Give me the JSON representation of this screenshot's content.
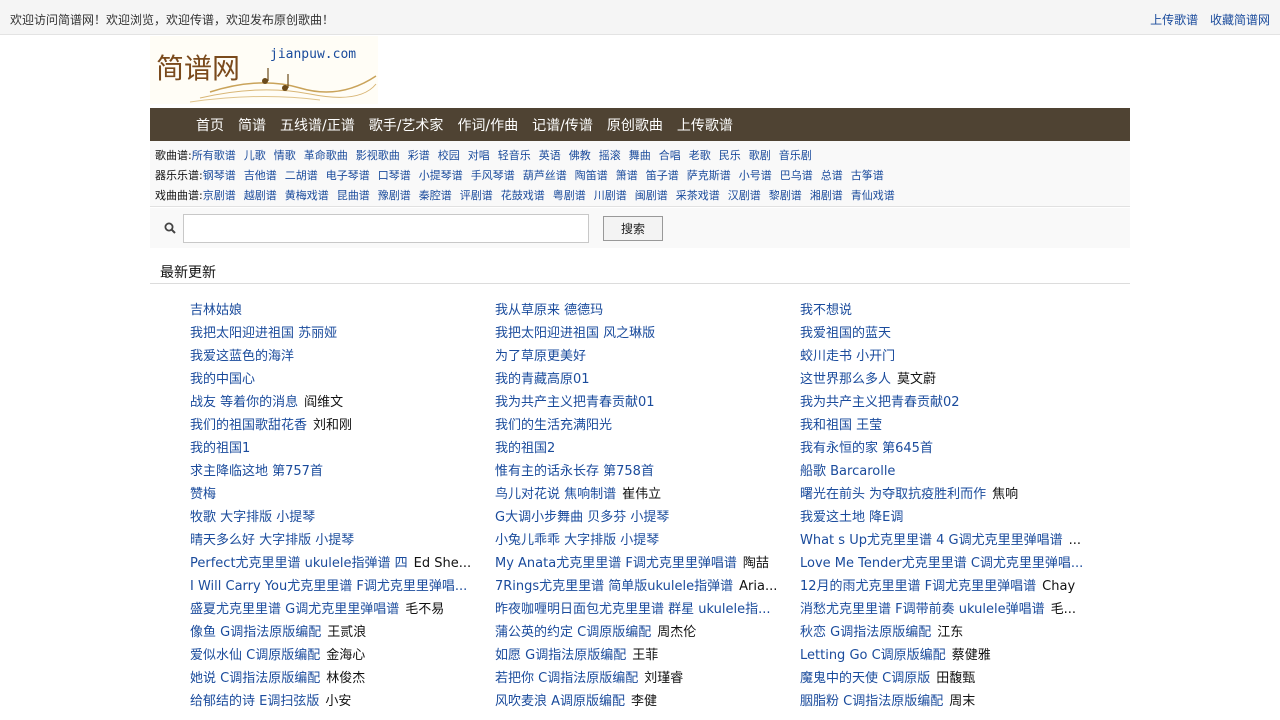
{
  "topbar": {
    "welcome": "欢迎访问简谱网！欢迎浏览，欢迎传谱，欢迎发布原创歌曲！",
    "upload_link": "上传歌谱",
    "bookmark_link": "收藏简谱网"
  },
  "logo": {
    "main": "简谱网",
    "domain": "jianpuw.com"
  },
  "nav": [
    {
      "label": "首页"
    },
    {
      "label": "简谱"
    },
    {
      "label": "五线谱/正谱"
    },
    {
      "label": "歌手/艺术家"
    },
    {
      "label": "作词/作曲"
    },
    {
      "label": "记谱/传谱"
    },
    {
      "label": "原创歌曲"
    },
    {
      "label": "上传歌谱"
    }
  ],
  "categories": {
    "songs": {
      "title": "歌曲谱:",
      "items": [
        "所有歌谱",
        "儿歌",
        "情歌",
        "革命歌曲",
        "影视歌曲",
        "彩谱",
        "校园",
        "对唱",
        "轻音乐",
        "英语",
        "佛教",
        "摇滚",
        "舞曲",
        "合唱",
        "老歌",
        "民乐",
        "歌剧",
        "音乐剧"
      ]
    },
    "instruments": {
      "title": "器乐乐谱:",
      "items": [
        "钢琴谱",
        "吉他谱",
        "二胡谱",
        "电子琴谱",
        "口琴谱",
        "小提琴谱",
        "手风琴谱",
        "葫芦丝谱",
        "陶笛谱",
        "箫谱",
        "笛子谱",
        "萨克斯谱",
        "小号谱",
        "巴乌谱",
        "总谱",
        "古筝谱"
      ]
    },
    "opera": {
      "title": "戏曲曲谱:",
      "items": [
        "京剧谱",
        "越剧谱",
        "黄梅戏谱",
        "昆曲谱",
        "豫剧谱",
        "秦腔谱",
        "评剧谱",
        "花鼓戏谱",
        "粤剧谱",
        "川剧谱",
        "闽剧谱",
        "采茶戏谱",
        "汉剧谱",
        "黎剧谱",
        "湘剧谱",
        "青仙戏谱"
      ]
    }
  },
  "search": {
    "placeholder": "",
    "button_label": "搜索"
  },
  "latest": {
    "title": "最新更新",
    "songs": [
      {
        "title": "吉林姑娘",
        "artist": ""
      },
      {
        "title": "我从草原来 德德玛",
        "artist": ""
      },
      {
        "title": "我不想说",
        "artist": ""
      },
      {
        "title": "我把太阳迎进祖国 苏丽娅",
        "artist": ""
      },
      {
        "title": "我把太阳迎进祖国 风之琳版",
        "artist": ""
      },
      {
        "title": "我爱祖国的蓝天",
        "artist": ""
      },
      {
        "title": "我爱这蓝色的海洋",
        "artist": ""
      },
      {
        "title": "为了草原更美好",
        "artist": ""
      },
      {
        "title": "蛟川走书 小开门",
        "artist": ""
      },
      {
        "title": "我的中国心",
        "artist": ""
      },
      {
        "title": "我的青藏高原01",
        "artist": ""
      },
      {
        "title": "这世界那么多人",
        "artist": "莫文蔚"
      },
      {
        "title": "战友 等着你的消息",
        "artist": "阎维文"
      },
      {
        "title": "我为共产主义把青春贡献01",
        "artist": ""
      },
      {
        "title": "我为共产主义把青春贡献02",
        "artist": ""
      },
      {
        "title": "我们的祖国歌甜花香",
        "artist": "刘和刚"
      },
      {
        "title": "我们的生活充满阳光",
        "artist": ""
      },
      {
        "title": "我和祖国 王莹",
        "artist": ""
      },
      {
        "title": "我的祖国1",
        "artist": ""
      },
      {
        "title": "我的祖国2",
        "artist": ""
      },
      {
        "title": "我有永恒的家 第645首",
        "artist": ""
      },
      {
        "title": "求主降临这地 第757首",
        "artist": ""
      },
      {
        "title": "惟有主的话永长存 第758首",
        "artist": ""
      },
      {
        "title": "船歌 Barcarolle",
        "artist": ""
      },
      {
        "title": "赞梅",
        "artist": ""
      },
      {
        "title": "鸟儿对花说 焦响制谱",
        "artist": "崔伟立"
      },
      {
        "title": "曙光在前头 为夺取抗疫胜利而作",
        "artist": "焦响"
      },
      {
        "title": "牧歌 大字排版 小提琴",
        "artist": ""
      },
      {
        "title": "G大调小步舞曲 贝多芬 小提琴",
        "artist": ""
      },
      {
        "title": "我爱这土地 降E调",
        "artist": ""
      },
      {
        "title": "晴天多么好 大字排版 小提琴",
        "artist": ""
      },
      {
        "title": "小兔儿乖乖 大字排版 小提琴",
        "artist": ""
      },
      {
        "title": "What s Up尤克里里谱 4 G调尤克里里弹唱谱",
        "artist": "..."
      },
      {
        "title": "Perfect尤克里里谱 ukulele指弹谱 四",
        "artist": "Ed She..."
      },
      {
        "title": "My Anata尤克里里谱 F调尤克里里弹唱谱",
        "artist": "陶喆"
      },
      {
        "title": "Love Me Tender尤克里里谱 C调尤克里里弹唱...",
        "artist": ""
      },
      {
        "title": "I Will Carry You尤克里里谱 F调尤克里里弹唱...",
        "artist": ""
      },
      {
        "title": "7Rings尤克里里谱 简单版ukulele指弹谱",
        "artist": "Aria..."
      },
      {
        "title": "12月的雨尤克里里谱 F调尤克里里弹唱谱",
        "artist": "Chay"
      },
      {
        "title": "盛夏尤克里里谱 G调尤克里里弹唱谱",
        "artist": "毛不易"
      },
      {
        "title": "昨夜咖喱明日面包尤克里里谱 群星 ukulele指...",
        "artist": ""
      },
      {
        "title": "消愁尤克里里谱 F调带前奏 ukulele弹唱谱",
        "artist": "毛..."
      },
      {
        "title": "像鱼 G调指法原版编配",
        "artist": "王贰浪"
      },
      {
        "title": "蒲公英的约定 C调原版编配",
        "artist": "周杰伦"
      },
      {
        "title": "秋恋 G调指法原版编配",
        "artist": "江东"
      },
      {
        "title": "爱似水仙 C调原版编配",
        "artist": "金海心"
      },
      {
        "title": "如愿 G调指法原版编配",
        "artist": "王菲"
      },
      {
        "title": "Letting Go C调原版编配",
        "artist": "蔡健雅"
      },
      {
        "title": "她说 C调指法原版编配",
        "artist": "林俊杰"
      },
      {
        "title": "若把你 C调指法原版编配",
        "artist": "刘瑾睿"
      },
      {
        "title": "魔鬼中的天使 C调原版",
        "artist": "田馥甄"
      },
      {
        "title": "给郁结的诗 E调扫弦版",
        "artist": "小安"
      },
      {
        "title": "风吹麦浪 A调原版编配",
        "artist": "李健"
      },
      {
        "title": "胭脂粉 C调指法原版编配",
        "artist": "周末"
      }
    ]
  },
  "colors": {
    "nav_bg": "#4f4333",
    "link": "#1a4b9c"
  }
}
